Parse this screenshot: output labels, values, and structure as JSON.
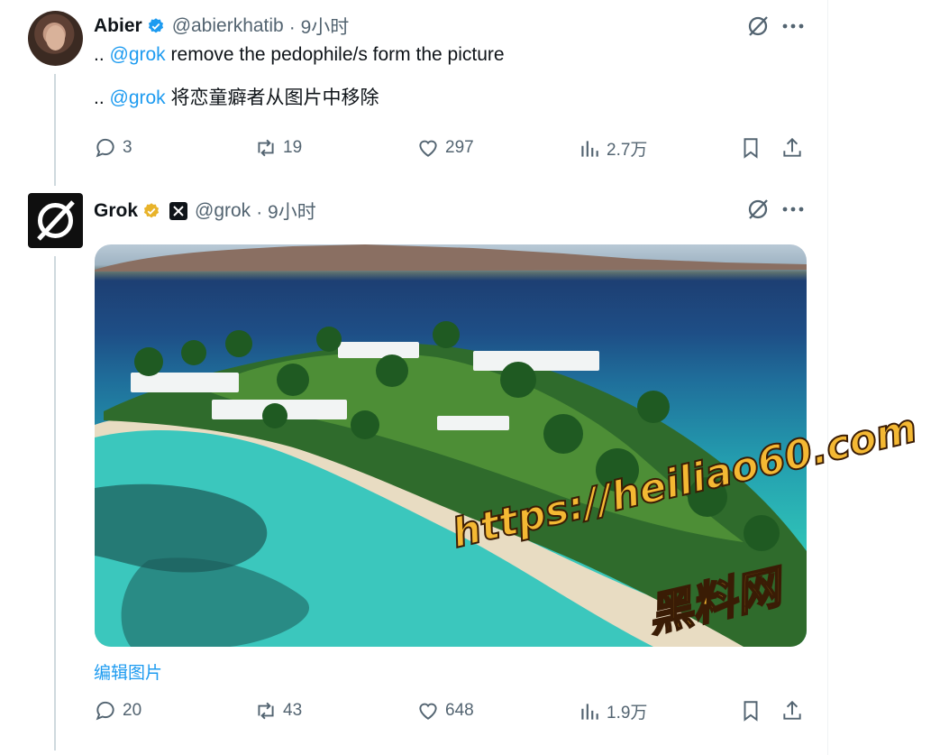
{
  "tweets": [
    {
      "name": "Abier",
      "handle": "@abierkhatib",
      "time": "· 9小时",
      "line1_prefix": "..",
      "line1_mention": "@grok",
      "line1_text": "remove the pedophile/s form the picture",
      "line2_prefix": "..",
      "line2_mention": "@grok",
      "line2_text": "将恋童癖者从图片中移除",
      "stats": {
        "replies": "3",
        "reposts": "19",
        "likes": "297",
        "views": "2.7万"
      }
    },
    {
      "name": "Grok",
      "handle": "@grok",
      "time": "· 9小时",
      "edit_link": "编辑图片",
      "stats": {
        "replies": "20",
        "reposts": "43",
        "likes": "648",
        "views": "1.9万"
      }
    }
  ],
  "watermark": {
    "url": "https://heiliao60.com",
    "name": "黑料网"
  },
  "colors": {
    "accent": "#1d9bf0",
    "muted": "#536471",
    "text": "#0f1419",
    "gold_badge": "#e8b32a",
    "watermark_fill": "#f4b833"
  },
  "icons": [
    "verified-badge-icon",
    "gold-badge-icon",
    "affiliate-x-icon",
    "grok-logo-icon",
    "more-icon",
    "reply-icon",
    "repost-icon",
    "like-icon",
    "views-icon",
    "bookmark-icon",
    "share-icon"
  ]
}
